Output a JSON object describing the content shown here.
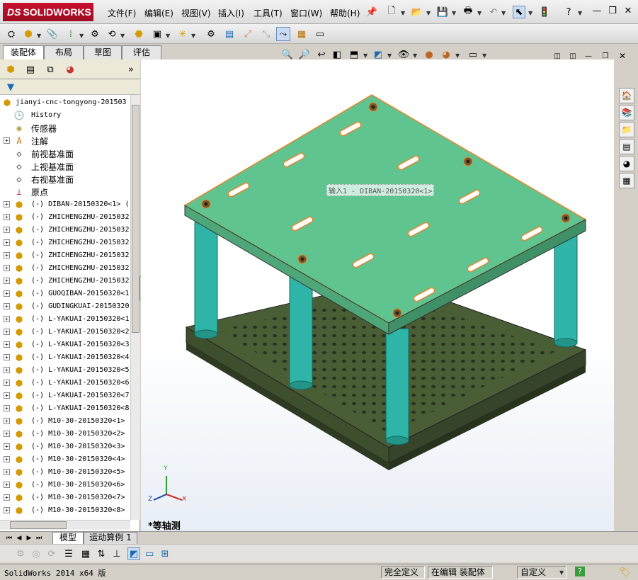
{
  "app": {
    "brand": "SOLIDWORKS",
    "brand_prefix": "DS"
  },
  "menu": [
    "文件(F)",
    "编辑(E)",
    "视图(V)",
    "插入(I)",
    "工具(T)",
    "窗口(W)",
    "帮助(H)"
  ],
  "window_controls": {
    "minimize": "—",
    "restore": "❐",
    "close": "✕"
  },
  "tabs": {
    "items": [
      "装配体",
      "布局",
      "草图",
      "评估"
    ],
    "active": 0
  },
  "feature_tree": {
    "root": "jianyi-cnc-tongyong-201503",
    "items": [
      {
        "label": "History",
        "icon": "history-icon",
        "expand": false,
        "cn": false
      },
      {
        "label": "传感器",
        "icon": "sensor-icon",
        "expand": false,
        "cn": true
      },
      {
        "label": "注解",
        "icon": "annotation-icon",
        "expand": true,
        "cn": true
      },
      {
        "label": "前视基准面",
        "icon": "plane-icon",
        "expand": false,
        "cn": true
      },
      {
        "label": "上视基准面",
        "icon": "plane-icon",
        "expand": false,
        "cn": true
      },
      {
        "label": "右视基准面",
        "icon": "plane-icon",
        "expand": false,
        "cn": true
      },
      {
        "label": "原点",
        "icon": "origin-icon",
        "expand": false,
        "cn": true
      },
      {
        "label": "(-) DIBAN-20150320<1> (",
        "icon": "part-icon",
        "expand": true,
        "cn": false
      },
      {
        "label": "(-) ZHICHENGZHU-2015032",
        "icon": "part-icon",
        "expand": true,
        "cn": false
      },
      {
        "label": "(-) ZHICHENGZHU-2015032",
        "icon": "part-icon",
        "expand": true,
        "cn": false
      },
      {
        "label": "(-) ZHICHENGZHU-2015032",
        "icon": "part-icon",
        "expand": true,
        "cn": false
      },
      {
        "label": "(-) ZHICHENGZHU-2015032",
        "icon": "part-icon",
        "expand": true,
        "cn": false
      },
      {
        "label": "(-) ZHICHENGZHU-2015032",
        "icon": "part-icon",
        "expand": true,
        "cn": false
      },
      {
        "label": "(-) ZHICHENGZHU-2015032",
        "icon": "part-icon",
        "expand": true,
        "cn": false
      },
      {
        "label": "(-) GUOQIBAN-20150320<1",
        "icon": "part-icon",
        "expand": true,
        "cn": false
      },
      {
        "label": "(-) GUDINGKUAI-20150320",
        "icon": "part-icon",
        "expand": true,
        "cn": false
      },
      {
        "label": "(-) L-YAKUAI-20150320<1",
        "icon": "part-icon",
        "expand": true,
        "cn": false
      },
      {
        "label": "(-) L-YAKUAI-20150320<2",
        "icon": "part-icon",
        "expand": true,
        "cn": false
      },
      {
        "label": "(-) L-YAKUAI-20150320<3",
        "icon": "part-icon",
        "expand": true,
        "cn": false
      },
      {
        "label": "(-) L-YAKUAI-20150320<4",
        "icon": "part-icon",
        "expand": true,
        "cn": false
      },
      {
        "label": "(-) L-YAKUAI-20150320<5",
        "icon": "part-icon",
        "expand": true,
        "cn": false
      },
      {
        "label": "(-) L-YAKUAI-20150320<6",
        "icon": "part-icon",
        "expand": true,
        "cn": false
      },
      {
        "label": "(-) L-YAKUAI-20150320<7",
        "icon": "part-icon",
        "expand": true,
        "cn": false
      },
      {
        "label": "(-) L-YAKUAI-20150320<8",
        "icon": "part-icon",
        "expand": true,
        "cn": false
      },
      {
        "label": "(-) M10-30-20150320<1>",
        "icon": "part-icon",
        "expand": true,
        "cn": false
      },
      {
        "label": "(-) M10-30-20150320<2>",
        "icon": "part-icon",
        "expand": true,
        "cn": false
      },
      {
        "label": "(-) M10-30-20150320<3>",
        "icon": "part-icon",
        "expand": true,
        "cn": false
      },
      {
        "label": "(-) M10-30-20150320<4>",
        "icon": "part-icon",
        "expand": true,
        "cn": false
      },
      {
        "label": "(-) M10-30-20150320<5>",
        "icon": "part-icon",
        "expand": true,
        "cn": false
      },
      {
        "label": "(-) M10-30-20150320<6>",
        "icon": "part-icon",
        "expand": true,
        "cn": false
      },
      {
        "label": "(-) M10-30-20150320<7>",
        "icon": "part-icon",
        "expand": true,
        "cn": false
      },
      {
        "label": "(-) M10-30-20150320<8>",
        "icon": "part-icon",
        "expand": true,
        "cn": false
      }
    ]
  },
  "viewport": {
    "tooltip": "输入1 - DIBAN-20150320<1>",
    "view_name": "*等轴测",
    "triad": {
      "x": "X",
      "y": "Y",
      "z": "Z"
    },
    "colors": {
      "plate_top": "#5fc490",
      "plate_edge": "#e8862a",
      "column": "#2fb5a8",
      "base": "#4a5e36"
    }
  },
  "bottom_tabs": [
    "模型",
    "运动算例 1"
  ],
  "status": {
    "version": "SolidWorks 2014 x64 版",
    "fully_defined": "完全定义",
    "editing": "在编辑 装配体",
    "units": "自定义",
    "help": "?"
  }
}
